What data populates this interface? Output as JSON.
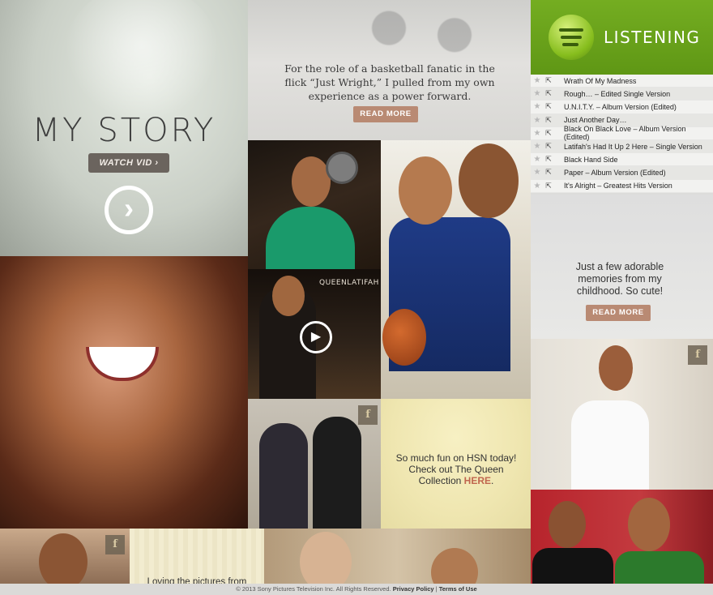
{
  "my_story": {
    "title": "MY STORY",
    "watch_label": "WATCH VID ›"
  },
  "basketball_post": {
    "text": "For the role of a basketball fanatic in the flick “Just Wright,” I pulled from my own experience as a power forward.",
    "read_more": "READ MORE"
  },
  "listening": {
    "title": "LISTENING",
    "brand_color": "#6aa51b",
    "tracks": [
      {
        "title": "Wrath Of My Madness"
      },
      {
        "title": "Rough… – Edited Single Version"
      },
      {
        "title": "U.N.I.T.Y. – Album Version (Edited)"
      },
      {
        "title": "Just Another Day…"
      },
      {
        "title": "Black On Black Love – Album Version (Edited)"
      },
      {
        "title": "Latifah's Had It Up 2 Here – Single Version"
      },
      {
        "title": "Black Hand Side"
      },
      {
        "title": "Paper – Album Version (Edited)"
      },
      {
        "title": "It's Alright – Greatest Hits Version"
      }
    ]
  },
  "memories_post": {
    "text": "Just a few adorable memories from my childhood. So cute!",
    "read_more": "READ MORE"
  },
  "video_tile": {
    "label": "QUEENLATIFAH"
  },
  "hsn_post": {
    "text": "So much fun on HSN today! Check out The Queen Collection",
    "link": "HERE",
    "period": "."
  },
  "pictures_post": {
    "text": "Loving the pictures from"
  },
  "facebook_badge": "f",
  "footer": {
    "copyright": "© 2013 Sony Pictures Television Inc. All Rights Reserved.",
    "privacy": "Privacy Policy",
    "separator": " | ",
    "terms": "Terms of Use"
  }
}
